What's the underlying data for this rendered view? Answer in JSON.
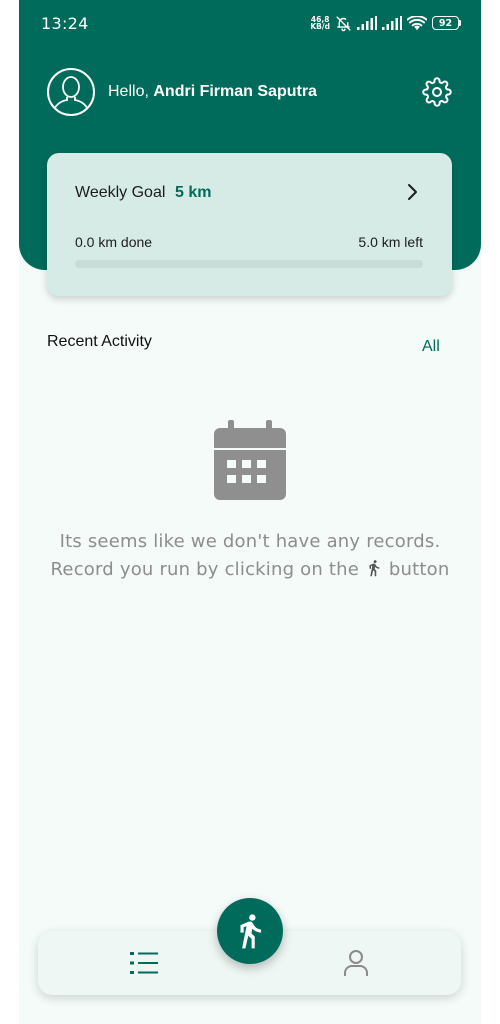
{
  "status_bar": {
    "time": "13:24",
    "net_speed_value": "46,8",
    "net_speed_unit": "KB/d",
    "battery": "92"
  },
  "header": {
    "greeting_prefix": "Hello, ",
    "user_name": "Andri Firman Saputra"
  },
  "weekly_goal": {
    "title": "Weekly Goal",
    "value": "5 km",
    "done_label": "0.0 km done",
    "left_label": "5.0 km left",
    "progress_fraction": 0.0
  },
  "recent_activity": {
    "title": "Recent Activity",
    "all_link": "All",
    "empty_line1": "Its seems like we don't have any records.",
    "empty_line2_prefix": "Record you run by clicking on the ",
    "empty_line2_suffix": " button"
  },
  "icons": {
    "avatar": "person-outline-icon",
    "settings": "gear-icon",
    "chevron": "chevron-right-icon",
    "empty_state": "calendar-icon",
    "run": "running-person-icon",
    "list": "list-icon",
    "profile": "person-icon"
  },
  "colors": {
    "primary": "#006b5b",
    "card": "#d6ebe5",
    "background": "#f4fbf9",
    "empty_text": "#8d8d8d"
  }
}
